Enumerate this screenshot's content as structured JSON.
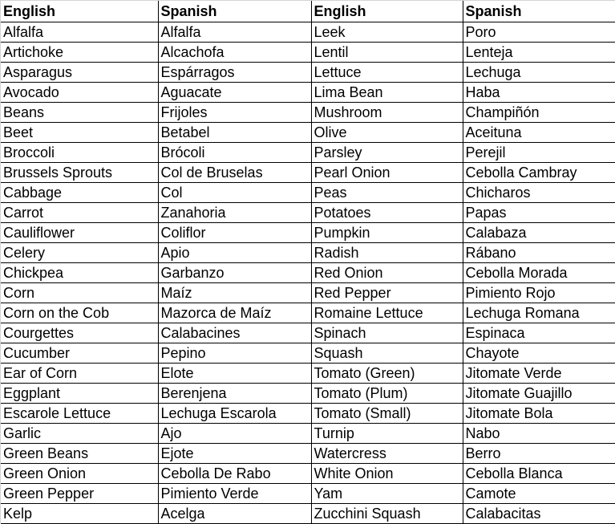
{
  "table": {
    "headers": [
      "English",
      "Spanish",
      "English",
      "Spanish"
    ],
    "rows": [
      [
        "Alfalfa",
        "Alfalfa",
        "Leek",
        "Poro"
      ],
      [
        "Artichoke",
        "Alcachofa",
        "Lentil",
        "Lenteja"
      ],
      [
        "Asparagus",
        "Espárragos",
        "Lettuce",
        "Lechuga"
      ],
      [
        "Avocado",
        "Aguacate",
        "Lima Bean",
        "Haba"
      ],
      [
        "Beans",
        "Frijoles",
        "Mushroom",
        "Champiñón"
      ],
      [
        "Beet",
        "Betabel",
        "Olive",
        "Aceituna"
      ],
      [
        "Broccoli",
        "Brócoli",
        "Parsley",
        "Perejil"
      ],
      [
        "Brussels Sprouts",
        "Col de Bruselas",
        "Pearl Onion",
        "Cebolla Cambray"
      ],
      [
        "Cabbage",
        "Col",
        "Peas",
        "Chicharos"
      ],
      [
        "Carrot",
        "Zanahoria",
        "Potatoes",
        "Papas"
      ],
      [
        "Cauliflower",
        "Coliflor",
        "Pumpkin",
        "Calabaza"
      ],
      [
        "Celery",
        "Apio",
        "Radish",
        "Rábano"
      ],
      [
        "Chickpea",
        "Garbanzo",
        "Red Onion",
        "Cebolla Morada"
      ],
      [
        "Corn",
        "Maíz",
        "Red Pepper",
        "Pimiento Rojo"
      ],
      [
        "Corn on the Cob",
        "Mazorca de Maíz",
        "Romaine Lettuce",
        "Lechuga Romana"
      ],
      [
        "Courgettes",
        "Calabacines",
        "Spinach",
        "Espinaca"
      ],
      [
        "Cucumber",
        "Pepino",
        "Squash",
        "Chayote"
      ],
      [
        "Ear of Corn",
        "Elote",
        "Tomato (Green)",
        "Jitomate Verde"
      ],
      [
        "Eggplant",
        "Berenjena",
        "Tomato (Plum)",
        "Jitomate Guajillo"
      ],
      [
        "Escarole Lettuce",
        "Lechuga Escarola",
        "Tomato (Small)",
        "Jitomate Bola"
      ],
      [
        "Garlic",
        "Ajo",
        "Turnip",
        "Nabo"
      ],
      [
        "Green Beans",
        "Ejote",
        "Watercress",
        "Berro"
      ],
      [
        "Green Onion",
        "Cebolla De Rabo",
        "White Onion",
        "Cebolla Blanca"
      ],
      [
        "Green Pepper",
        "Pimiento Verde",
        "Yam",
        "Camote"
      ],
      [
        "Kelp",
        "Acelga",
        "Zucchini Squash",
        "Calabacitas"
      ]
    ]
  }
}
